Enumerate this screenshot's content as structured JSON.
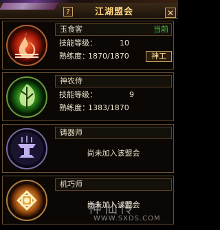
{
  "window": {
    "title": "江湖盟会",
    "help_icon": "?",
    "close_icon": "✕"
  },
  "panels": [
    {
      "name": "玉食客",
      "status": "当前",
      "skill_label": "技能等级：",
      "skill_value": "10",
      "prof_label": "熟练度：",
      "prof_value": "1870/1870",
      "action_label": "神工",
      "emblem": "fire-emblem-icon",
      "color": "#d03820"
    },
    {
      "name": "神农侍",
      "skill_label": "技能等级：",
      "skill_value": "9",
      "prof_label": "熟练度：",
      "prof_value": "1383/1870",
      "emblem": "leaf-emblem-icon",
      "color": "#3a9a30"
    },
    {
      "name": "铸器师",
      "not_joined": "尚未加入该盟会",
      "emblem": "anvil-emblem-icon",
      "color": "#6a4ac0"
    },
    {
      "name": "机巧师",
      "not_joined": "尚未加入该盟会",
      "emblem": "gear-emblem-icon",
      "color": "#e09020"
    }
  ],
  "watermark": {
    "line1": "神仙传",
    "line2": "WWW.SXDS.COM"
  }
}
